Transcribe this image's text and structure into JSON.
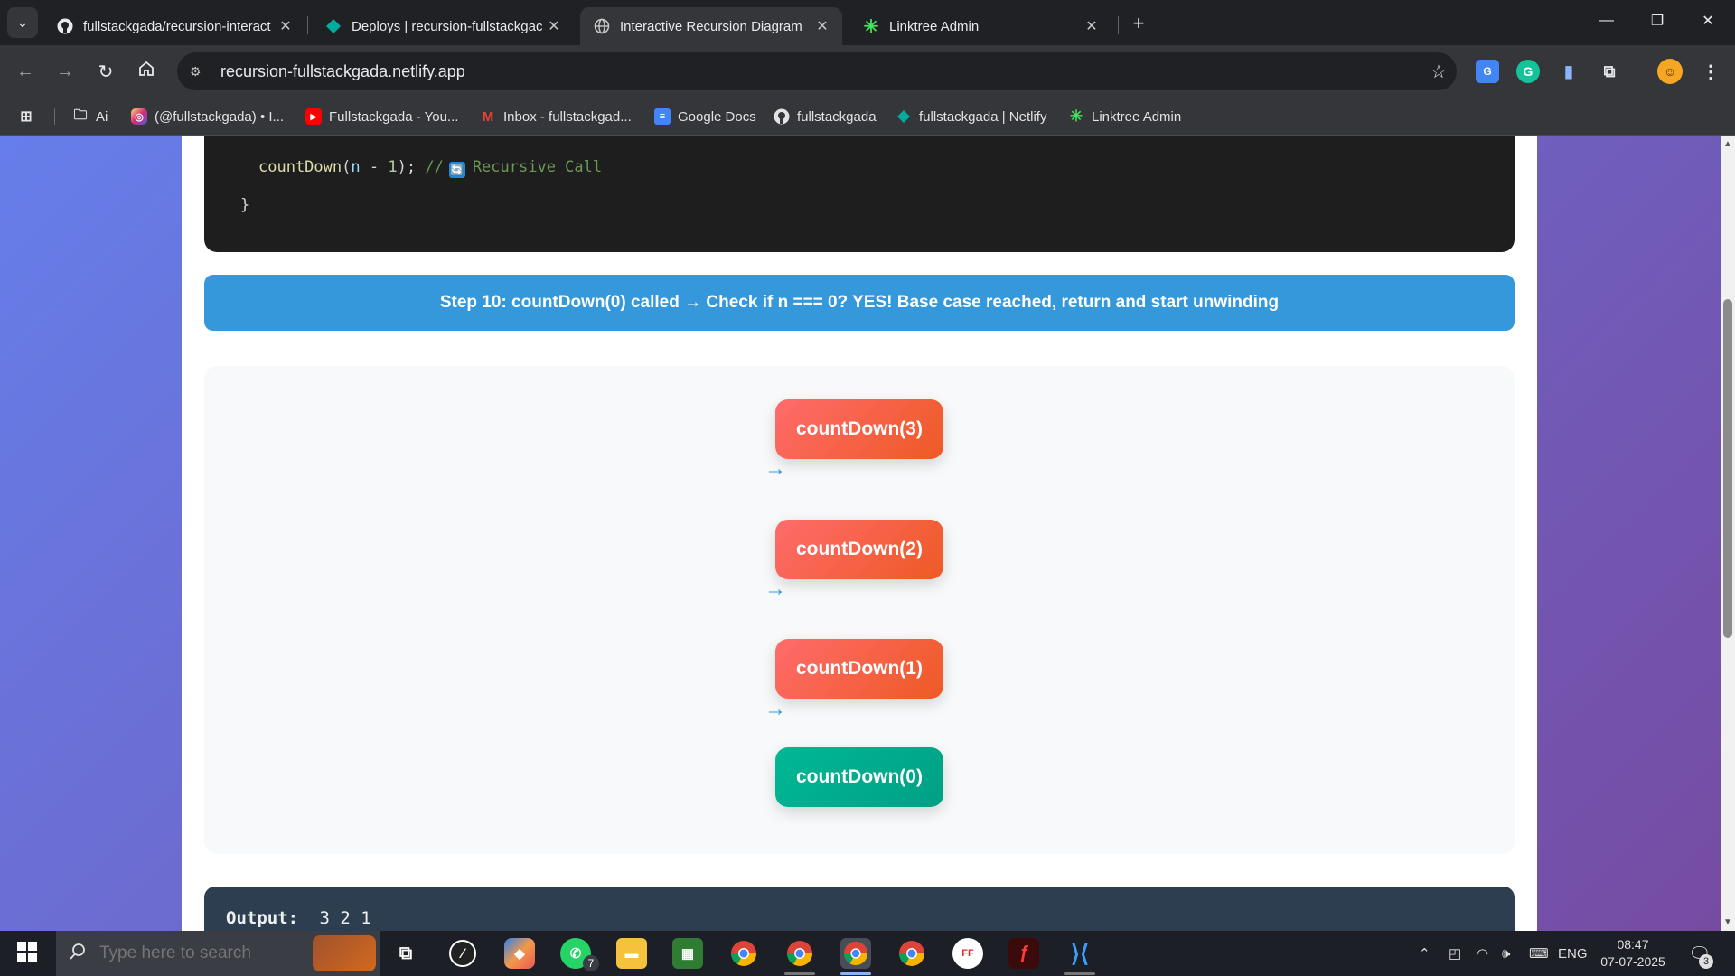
{
  "browser": {
    "tabs": [
      {
        "title": "fullstackgada/recursion-interact",
        "icon": "github-icon",
        "active": false
      },
      {
        "title": "Deploys | recursion-fullstackgac",
        "icon": "netlify-icon",
        "active": false
      },
      {
        "title": "Interactive Recursion Diagram",
        "icon": "globe-icon",
        "active": true
      },
      {
        "title": "Linktree Admin",
        "icon": "linktree-icon",
        "active": false
      }
    ],
    "url": "recursion-fullstackgada.netlify.app",
    "bookmarks": [
      {
        "label": "Ai",
        "icon": "folder-icon"
      },
      {
        "label": "(@fullstackgada) • I...",
        "icon": "instagram-icon"
      },
      {
        "label": "Fullstackgada - You...",
        "icon": "youtube-icon"
      },
      {
        "label": "Inbox - fullstackgad...",
        "icon": "gmail-icon"
      },
      {
        "label": "Google Docs",
        "icon": "google-docs-icon"
      },
      {
        "label": "fullstackgada",
        "icon": "github-icon"
      },
      {
        "label": "fullstackgada | Netlify",
        "icon": "netlify-icon"
      },
      {
        "label": "Linktree Admin",
        "icon": "linktree-icon"
      }
    ]
  },
  "page": {
    "code_lines": {
      "call_fn": "countDown",
      "call_open": "(",
      "call_var": "n",
      "call_op": " - ",
      "call_num": "1",
      "call_close": ");",
      "comment_prefix": "//",
      "comment_text": "Recursive Call",
      "closing_brace": "}"
    },
    "step_text": "Step 10: countDown(0) called → Check if n === 0? YES! Base case reached, return and start unwinding",
    "arrow_glyph": "→",
    "stack": [
      {
        "label": "countDown(3)",
        "state": "active"
      },
      {
        "label": "countDown(2)",
        "state": "active"
      },
      {
        "label": "countDown(1)",
        "state": "active"
      },
      {
        "label": "countDown(0)",
        "state": "base-case"
      }
    ],
    "output_label": "Output:",
    "output_value": "3 2 1",
    "colors": {
      "active_node": "#ee5a24",
      "base_node": "#00b894",
      "step_banner": "#3498db",
      "page_gradient_start": "#667eea",
      "page_gradient_end": "#764ba2"
    }
  },
  "taskbar": {
    "search_placeholder": "Type here to search",
    "whatsapp_badge": "7",
    "tray": {
      "language": "ENG",
      "time": "08:47",
      "date": "07-07-2025",
      "notification_count": "3"
    }
  }
}
